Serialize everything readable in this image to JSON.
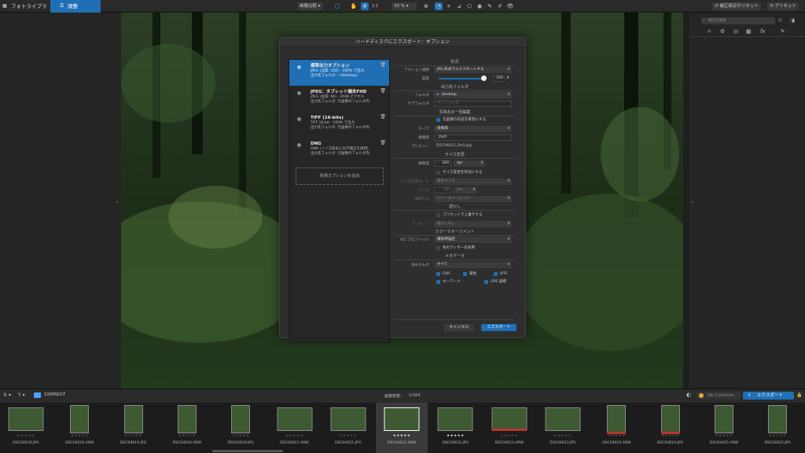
{
  "topbar": {
    "tab_library": "フォトライブラリ",
    "tab_customize": "調整",
    "compare_label": "画像比較",
    "zoom": "33 %",
    "reset_label": "補正設定のリセット",
    "presets_label": "プリセット"
  },
  "right_panel": {
    "search_placeholder": "補正を検索"
  },
  "dialog": {
    "title": "ハードディスクにエクスポート：オプション",
    "presets": [
      {
        "title": "標準出力オプション",
        "line1": "JPEG (品質: 100) - 100% で出力",
        "line2": "出力先フォルダ: ~/Desktop/"
      },
      {
        "title": "JPEG：タブレット端末FHD",
        "line1": "JPEG (品質: 90) - 2048 ピクセル",
        "line2": "出力先フォルダ: 元画像のフォルダ内"
      },
      {
        "title": "TIFF (16-bits)",
        "line1": "TIFF 16-bit - 100% で出力",
        "line2": "出力先フォルダ: 元画像のフォルダ内"
      },
      {
        "title": "DNG",
        "line1": "DNG (ノイズ除去と光学補正を適用)",
        "line2": "出力先フォルダ: 元画像のフォルダ内"
      }
    ],
    "add_option": "新規オプションを追加",
    "format_section": "形式",
    "action_label": "アクション選択",
    "action_value": "JPG 形式でエクスポートする",
    "quality_label": "品質",
    "quality_value": "100",
    "quality_level": 1.0,
    "output_folder_section": "出力先フォルダ",
    "folder_label": "フォルダ",
    "folder_value": "Desktop",
    "subfolder_label": "サブフォルダ",
    "subfolder_placeholder": "サブフォルダ",
    "rename_section": "写真名の一括編集",
    "keep_name_cb": "元画像の名前を再現にする",
    "type_label": "タイプ",
    "type_value": "接尾辞",
    "suffix_label": "接尾辞",
    "suffix_value": "_DxO",
    "preview_label": "プレビュー",
    "preview_value": "DSC04622_DxO.jpg",
    "resize_section": "サイズ変更",
    "resolution_label": "解像度",
    "resolution_value": "300",
    "resolution_unit": "dpi",
    "resize_cb": "サイズ変更を有効にする",
    "resize_mode_label": "サイズ変更モード",
    "resize_mode_value": "最長サイズ",
    "size_label": "サイズ",
    "size_value": "12",
    "size_unit": "cm",
    "interp_label": "補間方法",
    "interp_value": "バイ・キュービック",
    "watermark_section": "透かし",
    "watermark_cb": "プリセットで上書きする",
    "watermark_preset_label": "プリセット",
    "watermark_preset_value": "透かしなし",
    "color_section": "カラーマネージメント",
    "icc_label": "ICC プロファイル",
    "icc_value": "撮影時設定",
    "dither_cb": "色のディザーを採用",
    "metadata_section": "メタデータ",
    "metadata_label": "含めるもの",
    "metadata_value": "すべて",
    "meta_exif": "EXIF",
    "meta_keywords": "キーワード",
    "meta_attr": "属性",
    "meta_iptc": "IPTC",
    "meta_gps": "GPS 座標",
    "cancel": "キャンセル",
    "export": "エクスポート"
  },
  "filmbar": {
    "folder": "100MSDCF",
    "count_label": "画像枚数：",
    "count_value": "1/164",
    "nik_label": "Nik Collection",
    "export_label": "エクスポート"
  },
  "thumbnails": [
    {
      "name": "DSC04618.JPG",
      "stars": "★★★★★",
      "orient": "land",
      "selected": false,
      "red": false
    },
    {
      "name": "DSC04619.ARW",
      "stars": "★★★★★",
      "orient": "port",
      "selected": false,
      "red": false
    },
    {
      "name": "DSC04619.JPG",
      "stars": "★★★★★",
      "orient": "port",
      "selected": false,
      "red": false
    },
    {
      "name": "DSC04620.ARW",
      "stars": "★★★★★",
      "orient": "port",
      "selected": false,
      "red": false
    },
    {
      "name": "DSC04620.JPG",
      "stars": "★★★★★",
      "orient": "port",
      "selected": false,
      "red": false
    },
    {
      "name": "DSC04621.ARW",
      "stars": "★★★★★",
      "orient": "land",
      "selected": false,
      "red": false
    },
    {
      "name": "DSC04621.JPG",
      "stars": "★★★★★",
      "orient": "land",
      "selected": false,
      "red": false
    },
    {
      "name": "DSC04622.ARW",
      "stars": "★★★★★",
      "orient": "land",
      "selected": true,
      "red": false
    },
    {
      "name": "DSC04622.JPG",
      "stars": "★★★★★",
      "orient": "land",
      "selected": false,
      "red": false
    },
    {
      "name": "DSC04623.ARW",
      "stars": "★★★★★",
      "orient": "land",
      "selected": false,
      "red": true
    },
    {
      "name": "DSC04623.JPG",
      "stars": "★★★★★",
      "orient": "land",
      "selected": false,
      "red": false
    },
    {
      "name": "DSC04624.ARW",
      "stars": "★★★★★",
      "orient": "port",
      "selected": false,
      "red": true
    },
    {
      "name": "DSC04624.JPG",
      "stars": "★★★★★",
      "orient": "port",
      "selected": false,
      "red": true
    },
    {
      "name": "DSC04625.ARW",
      "stars": "★★★★★",
      "orient": "port",
      "selected": false,
      "red": false
    },
    {
      "name": "DSC04625.JPG",
      "stars": "★★★★★",
      "orient": "port",
      "selected": false,
      "red": false
    }
  ],
  "colors": {
    "accent": "#1f6fb4",
    "background": "#1f1f1f",
    "rating_red": "#b8362c"
  }
}
